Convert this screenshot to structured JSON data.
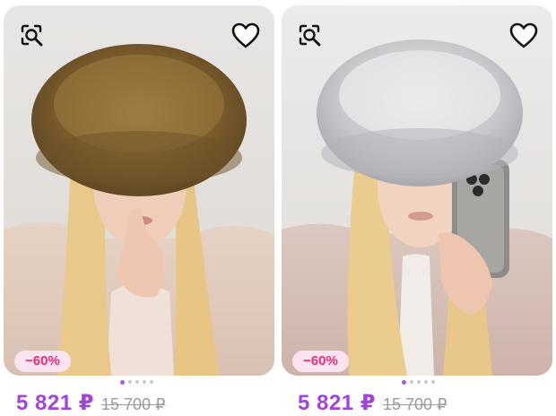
{
  "products": [
    {
      "discount": "−60%",
      "price": "5 821 ₽",
      "old_price": "15 700 ₽",
      "hat_color": "#8a6a34",
      "dots_total": 5,
      "dots_active": 0
    },
    {
      "discount": "−60%",
      "price": "5 821 ₽",
      "old_price": "15 700 ₽",
      "hat_color": "#c9c9cc",
      "dots_total": 5,
      "dots_active": 0
    }
  ],
  "icons": {
    "search": "image-search-icon",
    "favorite": "heart-outline-icon"
  },
  "colors": {
    "price": "#a045d8",
    "badge_text": "#ec2a7a",
    "badge_bg": "#fbe3ef"
  }
}
